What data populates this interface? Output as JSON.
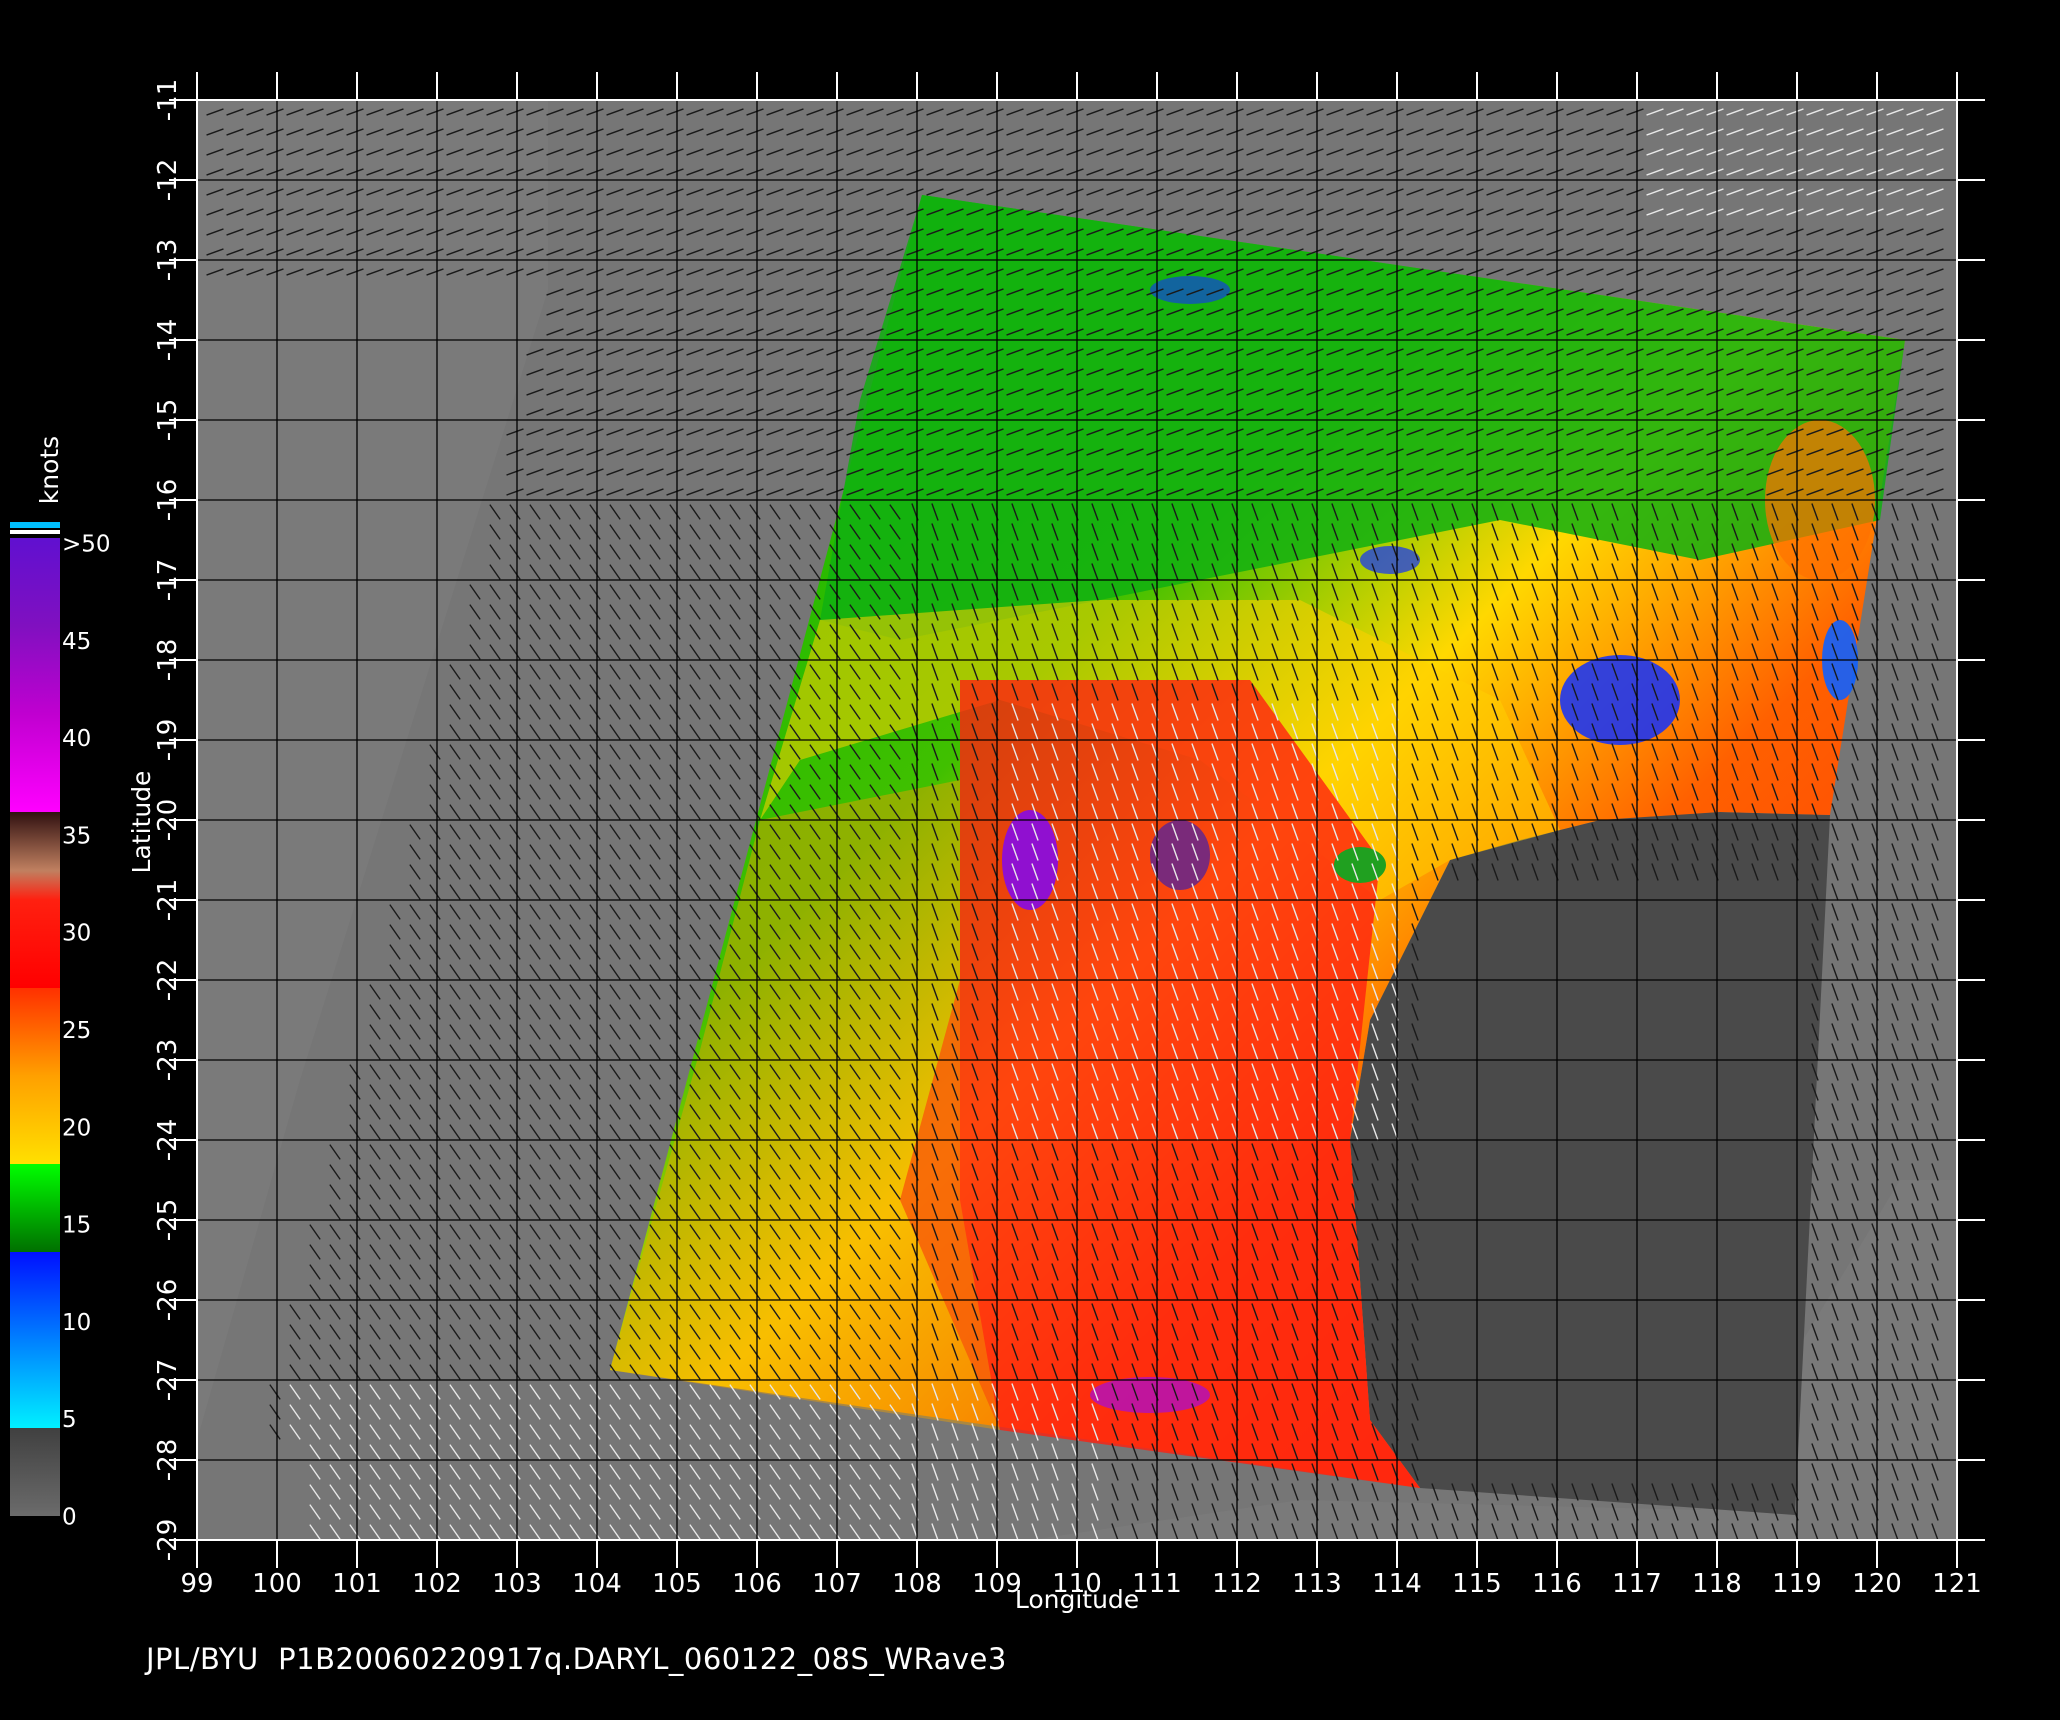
{
  "footer": "JPL/BYU  P1B20060220917q.DARYL_060122_08S_WRave3",
  "axes": {
    "xlabel": "Longitude",
    "ylabel": "Latitude",
    "lon_ticks": [
      99,
      100,
      101,
      102,
      103,
      104,
      105,
      106,
      107,
      108,
      109,
      110,
      111,
      112,
      113,
      114,
      115,
      116,
      117,
      118,
      119,
      120,
      121
    ],
    "lat_ticks": [
      -11,
      -12,
      -13,
      -14,
      -15,
      -16,
      -17,
      -18,
      -19,
      -20,
      -21,
      -22,
      -23,
      -24,
      -25,
      -26,
      -27,
      -28,
      -29
    ]
  },
  "colorbar": {
    "title": "knots",
    "labels": [
      ">50",
      "45",
      "40",
      "35",
      "30",
      "25",
      "20",
      "15",
      "10",
      "5",
      "0"
    ],
    "colors": {
      "0": "#6b6b6b",
      "5": "#00f0ff",
      "10": "#0060ff",
      "15": "#00a000",
      "20": "#ffe000",
      "25": "#ff7000",
      "30": "#ff1010",
      "35": "#b07050",
      "40": "#ff00ff",
      "45": "#9010d0"
    }
  },
  "colors": {
    "background": "#000000",
    "ocean_no_data": "#7a7a7a",
    "land": "#4a4a4a",
    "grid": "#000000"
  }
}
